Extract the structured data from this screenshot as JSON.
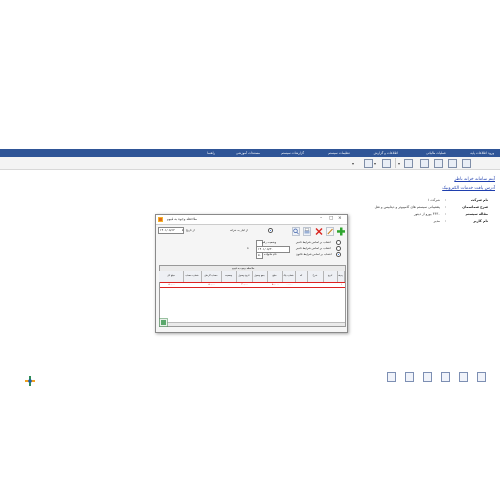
{
  "menu": {
    "items": [
      "ورود اطلاعات پایه",
      "عملیات مالیاتی",
      "اطلاعات و گزارش",
      "تنظیمات سیستم",
      "گزارشات سیستم",
      "مستندات آموزشی",
      "راهنما"
    ]
  },
  "sidebar": {
    "link1": "آیتم سامانه خزانه ناظر",
    "link2": "آدرس یافت خدمات الکترونیک"
  },
  "info": {
    "rows": [
      {
        "label": "نام شرکت",
        "value": "شرکت ۱"
      },
      {
        "label": "شرح شماسمان",
        "value": "پشتیبانی سیستم های کامپیوتر و دیتابیس و نقل"
      },
      {
        "label": "مقاله سیستم",
        "value": "۳۶۳۰ یورو از دیتور"
      },
      {
        "label": "نام کاربر",
        "value": "مدیر"
      }
    ]
  },
  "dialog": {
    "title": "ملاحظه وجوه به قیوم",
    "from_label": "از تاریخ",
    "from_date": "۱۴۰۱/۰۸/۱۲",
    "to_date": "۱۴۰۱/۰۸/۳۰",
    "to_label": "تا",
    "checkbox_label": "از انبار به خزانه",
    "options": [
      "انتخاب بر اساس شرایط تاخیر",
      "انتخاب بر اساس شرایط تاخیر",
      "انتخاب بر اساس شرایط قانون"
    ],
    "status_label": "وضعیت رقم",
    "status_value": "۵۰",
    "filter_label": "نام خانواده",
    "grid_title": "ملاحظه وجوه به قیوم",
    "columns": [
      "ردیف",
      "تاریخ",
      "شرح",
      "کد",
      "شماره چک",
      "مبلغ",
      "جمع وصول",
      "تاریخ وصول",
      "وضعیت",
      "حساب گردش",
      "شماره حساب",
      "مبلغ کل"
    ],
    "row": [
      "۱",
      "",
      "",
      "",
      "۰۰۰۰۰",
      "۵۰,۰۰۰",
      "",
      "۲۰,۰۰۰",
      "",
      "۵۰,۰۰۰",
      "",
      "۵۰,۰۰۰"
    ]
  },
  "colors": {
    "accent": "#2f5597",
    "row_highlight": "#d20000",
    "link": "#1f3fae"
  }
}
